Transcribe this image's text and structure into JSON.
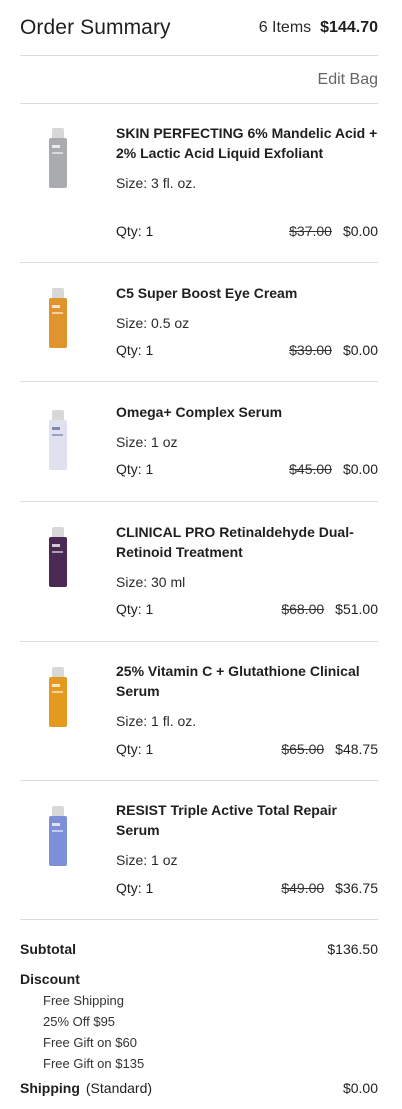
{
  "header": {
    "title": "Order Summary",
    "items_count": "6 Items",
    "total": "$144.70"
  },
  "edit_bag": "Edit Bag",
  "items": [
    {
      "name": "SKIN PERFECTING 6% Mandelic Acid + 2% Lactic Acid Liquid Exfoliant",
      "size": "Size: 3 fl. oz.",
      "qty": "Qty: 1",
      "original_price": "$37.00",
      "price": "$0.00",
      "bottle_color": "#a9abaf"
    },
    {
      "name": "C5 Super Boost Eye Cream",
      "size": "Size: 0.5 oz",
      "qty": "Qty: 1",
      "original_price": "$39.00",
      "price": "$0.00",
      "bottle_color": "#e0942e"
    },
    {
      "name": "Omega+ Complex Serum",
      "size": "Size: 1 oz",
      "qty": "Qty: 1",
      "original_price": "$45.00",
      "price": "$0.00",
      "bottle_color": "#dfe2ee"
    },
    {
      "name": "CLINICAL PRO Retinaldehyde Dual-Retinoid Treatment",
      "size": "Size: 30 ml",
      "qty": "Qty: 1",
      "original_price": "$68.00",
      "price": "$51.00",
      "bottle_color": "#4a2a55"
    },
    {
      "name": "25% Vitamin C + Glutathione Clinical Serum",
      "size": "Size: 1 fl. oz.",
      "qty": "Qty: 1",
      "original_price": "$65.00",
      "price": "$48.75",
      "bottle_color": "#e39a1f"
    },
    {
      "name": "RESIST Triple Active Total Repair Serum",
      "size": "Size: 1 oz",
      "qty": "Qty: 1",
      "original_price": "$49.00",
      "price": "$36.75",
      "bottle_color": "#7d8fd6"
    }
  ],
  "summary": {
    "subtotal_label": "Subtotal",
    "subtotal_value": "$136.50",
    "discount_label": "Discount",
    "discounts": [
      "Free Shipping",
      "25% Off $95",
      "Free Gift on $60",
      "Free Gift on $135"
    ],
    "shipping_label": "Shipping",
    "shipping_type": "(Standard)",
    "shipping_value": "$0.00"
  }
}
